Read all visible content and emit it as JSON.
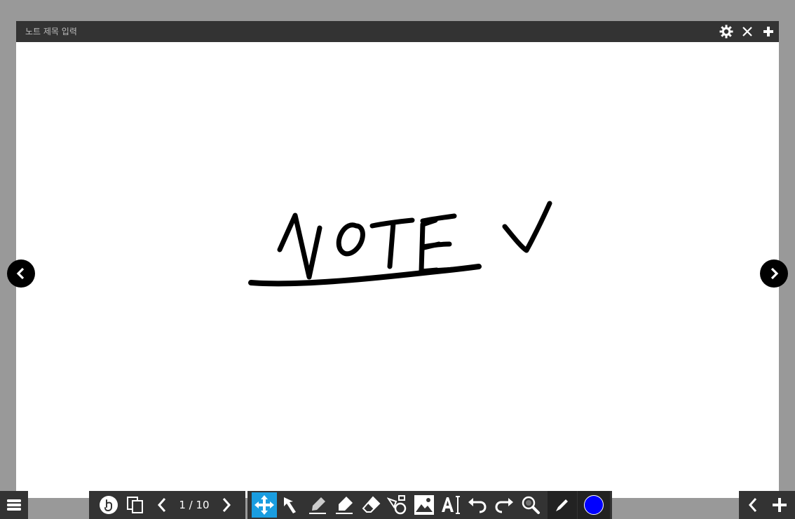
{
  "note": {
    "title_placeholder": "노트 제목 입력",
    "title_value": ""
  },
  "title_bar": {
    "icons": [
      "gear-icon",
      "close-icon",
      "plus-icon"
    ]
  },
  "pagination": {
    "current": 1,
    "total": 10,
    "label": "1 / 10"
  },
  "toolbar": {
    "left_tools": [
      "menu-icon"
    ],
    "page_tools": [
      "hand-gesture-icon",
      "page-copy-icon",
      "prev-page-icon",
      "next-page-icon"
    ],
    "drawing_tools": [
      "move-icon",
      "select-arrow-icon",
      "pen-icon",
      "highlighter-icon",
      "eraser-icon",
      "shape-tool-icon",
      "image-icon",
      "text-icon",
      "undo-icon",
      "redo-icon",
      "zoom-icon"
    ],
    "active_tool": "move-icon",
    "pen_style_icon": "pen-line-icon",
    "current_color": "#0000ff",
    "right_tools": [
      "collapse-left-icon",
      "add-page-icon"
    ]
  },
  "colors": {
    "background": "#999999",
    "titlebar": "#333333",
    "toolbar": "#333333",
    "accent": "#1a9de0",
    "ink": "#000000"
  }
}
